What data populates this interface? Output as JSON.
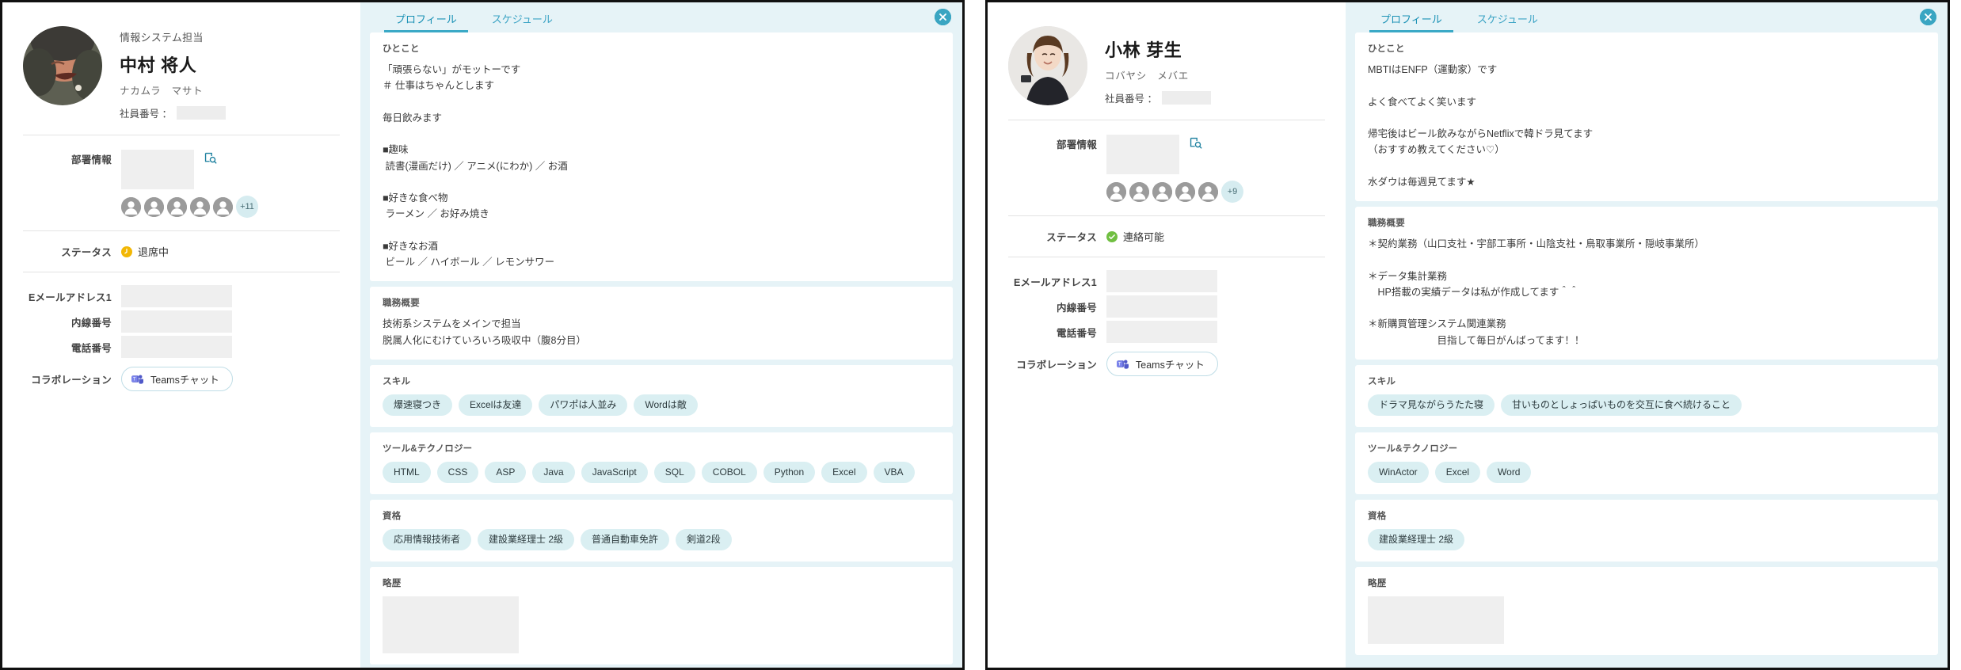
{
  "cards": [
    {
      "profile": {
        "role": "情報システム担当",
        "name": "中村 将人",
        "kana": "ナカムラ　マサト",
        "employee_no_label": "社員番号 ：",
        "employee_no_value": "",
        "dept_label": "部署情報",
        "dept_value": "",
        "member_overflow": "+11",
        "status_label": "ステータス",
        "status_text": "退席中",
        "status_color": "#f2b705",
        "status_icon": "clock-icon",
        "email_label": "Eメールアドレス1",
        "email_value": "",
        "ext_label": "内線番号",
        "ext_value": "",
        "tel_label": "電話番号",
        "tel_value": "",
        "collab_label": "コラボレーション",
        "collab_button": "Teamsチャット",
        "avatar_alt": "中村 将人 のプロフィール写真"
      },
      "tabs": [
        {
          "label": "プロフィール",
          "active": true
        },
        {
          "label": "スケジュール",
          "active": false
        }
      ],
      "sections": {
        "hitokoto_title": "ひとこと",
        "hitokoto_text": "「頑張らない」がモットーです\n＃ 仕事はちゃんとします\n\n毎日飲みます\n\n■趣味\n 読書(漫画だけ) ／ アニメ(にわか) ／ お酒\n\n■好きな食べ物\n ラーメン ／ お好み焼き\n\n■好きなお酒\n ビール ／ ハイボール ／ レモンサワー",
        "summary_title": "職務概要",
        "summary_text": "技術系システムをメインで担当\n脱属人化にむけていろいろ吸収中（腹8分目）",
        "skill_title": "スキル",
        "skills": [
          "爆速寝つき",
          "Excelは友達",
          "パワポは人並み",
          "Wordは敵"
        ],
        "tools_title": "ツール&テクノロジー",
        "tools": [
          "HTML",
          "CSS",
          "ASP",
          "Java",
          "JavaScript",
          "SQL",
          "COBOL",
          "Python",
          "Excel",
          "VBA"
        ],
        "quals_title": "資格",
        "quals": [
          "応用情報技術者",
          "建設業経理士 2級",
          "普通自動車免許",
          "剣道2段"
        ],
        "history_title": "略歴",
        "history_value": ""
      }
    },
    {
      "profile": {
        "role": "",
        "name": "小林 芽生",
        "kana": "コバヤシ　メバエ",
        "employee_no_label": "社員番号 ：",
        "employee_no_value": "",
        "dept_label": "部署情報",
        "dept_value": "",
        "member_overflow": "+9",
        "status_label": "ステータス",
        "status_text": "連絡可能",
        "status_color": "#70bf41",
        "status_icon": "check-circle-icon",
        "email_label": "Eメールアドレス1",
        "email_value": "",
        "ext_label": "内線番号",
        "ext_value": "",
        "tel_label": "電話番号",
        "tel_value": "",
        "collab_label": "コラボレーション",
        "collab_button": "Teamsチャット",
        "avatar_alt": "小林 芽生 のプロフィール写真"
      },
      "tabs": [
        {
          "label": "プロフィール",
          "active": true
        },
        {
          "label": "スケジュール",
          "active": false
        }
      ],
      "sections": {
        "hitokoto_title": "ひとこと",
        "hitokoto_text": "MBTIはENFP（運動家）です\n\nよく食べてよく笑います\n\n帰宅後はビール飲みながらNetflixで韓ドラ見てます\n（おすすめ教えてください♡）\n\n水ダウは毎週見てます★",
        "summary_title": "職務概要",
        "summary_text": "＊契約業務（山口支社・宇部工事所・山陰支社・鳥取事業所・隠岐事業所）\n\n＊データ集計業務\n　HP搭載の実績データは私が作成してます＾＾\n\n＊新購買管理システム関連業務\n　　　　　　　目指して毎日がんばってます！！",
        "skill_title": "スキル",
        "skills": [
          "ドラマ見ながらうたた寝",
          "甘いものとしょっぱいものを交互に食べ続けること"
        ],
        "tools_title": "ツール&テクノロジー",
        "tools": [
          "WinActor",
          "Excel",
          "Word"
        ],
        "quals_title": "資格",
        "quals": [
          "建設業経理士 2級"
        ],
        "history_title": "略歴",
        "history_value": ""
      }
    }
  ],
  "icons": {
    "search": "dept-search-icon",
    "close": "close-icon",
    "teams": "teams-icon"
  },
  "colors": {
    "accent": "#3aa5c2",
    "panel_bg": "#e6f3f7",
    "chip_bg": "#daeff2"
  }
}
